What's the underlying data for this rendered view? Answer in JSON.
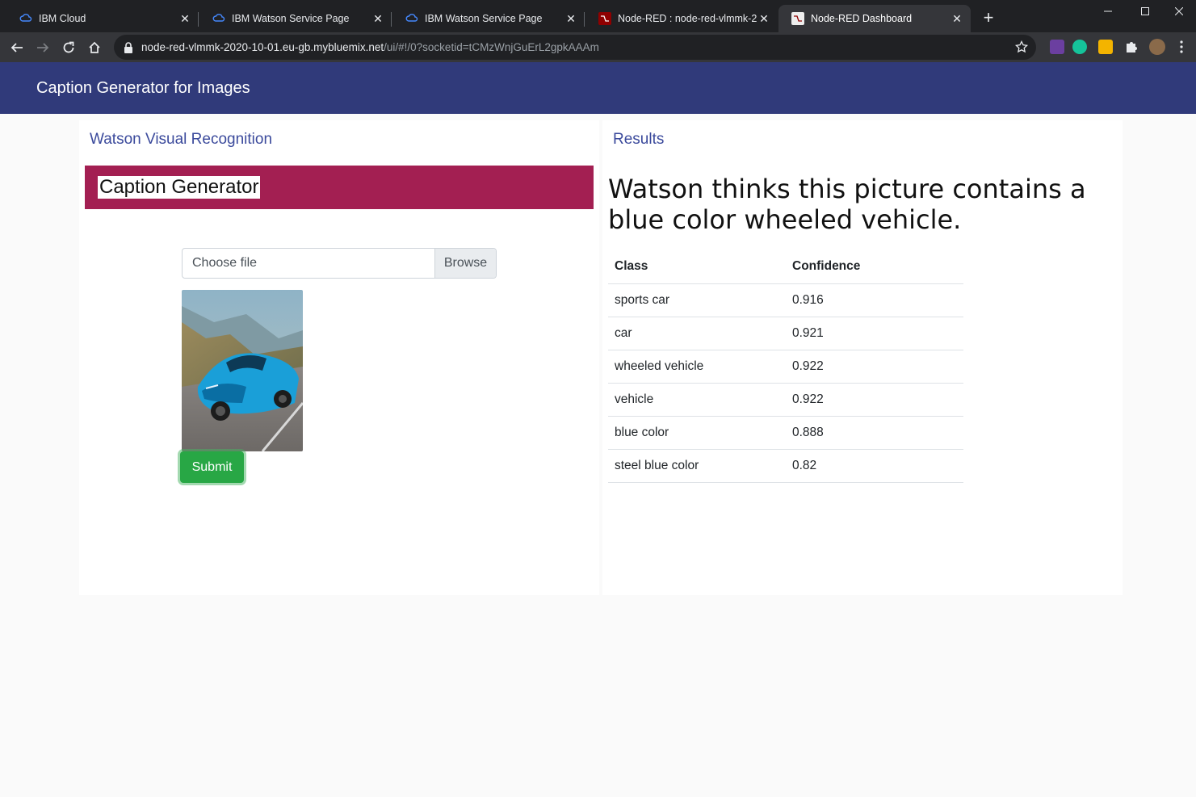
{
  "browser": {
    "tabs": [
      {
        "title": "IBM Cloud",
        "favicon": "ibm-cloud-icon",
        "active": false
      },
      {
        "title": "IBM Watson Service Page",
        "favicon": "ibm-cloud-icon",
        "active": false
      },
      {
        "title": "IBM Watson Service Page",
        "favicon": "ibm-cloud-icon",
        "active": false
      },
      {
        "title": "Node-RED : node-red-vlmmk-20",
        "favicon": "node-red-icon",
        "active": false
      },
      {
        "title": "Node-RED Dashboard",
        "favicon": "node-red-icon",
        "active": true
      }
    ],
    "url_host": "node-red-vlmmk-2020-10-01.eu-gb.mybluemix.net",
    "url_path": "/ui/#!/0?socketid=tCMzWnjGuErL2gpkAAAm"
  },
  "header": {
    "title": "Caption Generator for Images",
    "color": "#303a7a"
  },
  "left_group": {
    "title": "Watson Visual Recognition",
    "banner_text": "Caption Generator",
    "banner_color": "#a31f52",
    "file_placeholder": "Choose file",
    "browse_label": "Browse",
    "submit_label": "Submit",
    "preview_image": "blue-sports-car-photo"
  },
  "right_group": {
    "title": "Results",
    "headline": "Watson thinks this picture contains a blue color wheeled vehicle.",
    "table": {
      "headers": [
        "Class",
        "Confidence"
      ],
      "rows": [
        [
          "sports car",
          "0.916"
        ],
        [
          "car",
          "0.921"
        ],
        [
          "wheeled vehicle",
          "0.922"
        ],
        [
          "vehicle",
          "0.922"
        ],
        [
          "blue color",
          "0.888"
        ],
        [
          "steel blue color",
          "0.82"
        ]
      ]
    }
  }
}
